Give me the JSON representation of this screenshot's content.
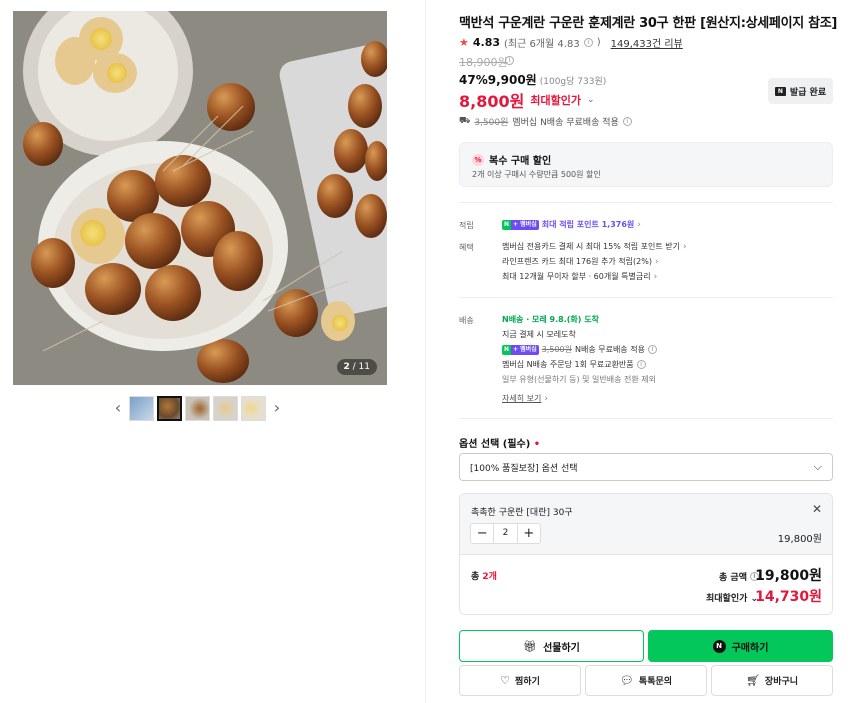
{
  "gallery": {
    "counter_current": "2",
    "counter_sep": " / ",
    "counter_total": "11",
    "prev_icon": "‹",
    "next_icon": "›"
  },
  "product": {
    "title": "맥반석 구운계란 구운란 훈제계란 30구 한판 [원산지:상세페이지 참조]",
    "rating": "4.83",
    "rating_recent": "(최근 6개월 4.83",
    "review_count": "149,433건 리뷰",
    "original_price": "18,900원",
    "discount_line": "47%9,900원",
    "unit_price": "(100g당 733원)",
    "max_discount_price": "8,800원",
    "max_discount_label": "최대할인가",
    "coupon_button": "발급 완료",
    "shipping_strike": "3,500원",
    "shipping_text": "멤버십 N배송 무료배송 적용"
  },
  "multi_discount": {
    "badge": "%",
    "title": "복수 구매 할인",
    "desc": "2개 이상 구매시 수량만큼 500원 할인"
  },
  "benefits": {
    "point_label": "적립",
    "badge_n": "N",
    "badge_plus": "+ 멤버십",
    "point_text": "최대 적립 포인트 1,376원",
    "benefit_label": "혜택",
    "benefit_1": "멤버십 전용카드 결제 시 최대 15% 적립 포인트 받기",
    "benefit_2": "라인프렌즈 카드 최대 176원 추가 적립(2%)",
    "benefit_3": "최대 12개월 무이자 할부 · 60개월 특별금리"
  },
  "delivery": {
    "label": "배송",
    "arrival": "N배송 · 모레 9.8.(화) 도착",
    "line_1": "지금 결제 시 모레도착",
    "strike": "3,500원",
    "line_2": "N배송 무료배송 적용",
    "line_3": "멤버십 N배송 주문당 1회 무료교환반품",
    "line_4": "일부 유형(선물하기 등) 및 일반배송 전환 제외",
    "more": "자세히 보기"
  },
  "options": {
    "title": "옵션 선택 (필수)",
    "selected": "[100% 품질보장] 옵션 선택"
  },
  "selection": {
    "name": "촉촉한 구운란 [대란] 30구",
    "quantity": "2",
    "price": "19,800원",
    "total_count_prefix": "총 ",
    "total_count": "2개",
    "total_label": "총 금액",
    "total_value": "19,800원",
    "max_label": "최대할인가",
    "max_value": "14,730원"
  },
  "actions": {
    "gift": "선물하기",
    "buy": "구매하기",
    "wish": "찜하기",
    "talk": "톡톡문의",
    "cart": "장바구니"
  }
}
